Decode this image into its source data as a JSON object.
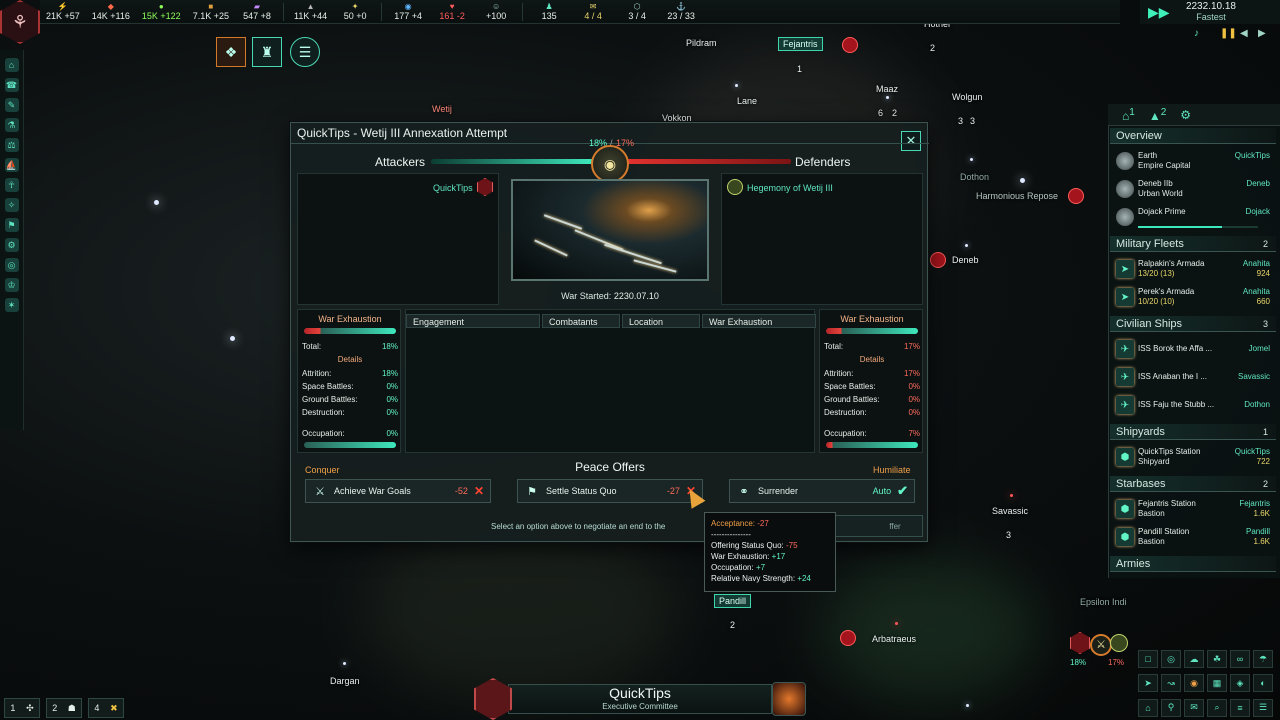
{
  "topbar": {
    "resources": [
      {
        "icon": "energy-icon",
        "value": "21K +57"
      },
      {
        "icon": "minerals-icon",
        "value": "14K +116"
      },
      {
        "icon": "food-icon",
        "value": "15K +122",
        "color": "#8cff5a"
      },
      {
        "icon": "consumer-goods-icon",
        "value": "7.1K +25"
      },
      {
        "icon": "alloys-icon",
        "value": "547 +8"
      },
      {
        "icon": "influence-icon",
        "value": "11K +44"
      },
      {
        "icon": "unity-icon",
        "value": "50 +0"
      },
      {
        "icon": "research-icon",
        "value": "177 +4"
      },
      {
        "icon": "stability-icon",
        "value": "161 -2",
        "negative": true
      },
      {
        "icon": "amenities-icon",
        "value": "+100"
      },
      {
        "icon": "pops-icon",
        "value": "135"
      },
      {
        "icon": "envoys-icon",
        "value": "4 / 4",
        "color": "#e8d66a"
      },
      {
        "icon": "starbases-icon",
        "value": "3 / 4"
      },
      {
        "icon": "naval-capacity-icon",
        "value": "23 / 33"
      }
    ],
    "date": "2232.10.18",
    "speed": "Fastest"
  },
  "window": {
    "title": "QuickTips - Wetij III Annexation Attempt",
    "attackers_label": "Attackers",
    "defenders_label": "Defenders",
    "attacker_pct": "18%",
    "defender_pct": "17%",
    "slash": "/",
    "attacker_name": "QuickTips",
    "defender_name": "Hegemony of Wetij III",
    "war_started_label": "War Started:",
    "war_started_date": "2230.07.10",
    "exhaustion_left": {
      "title": "War Exhaustion",
      "total_label": "Total:",
      "total": "18%",
      "details": "Details",
      "rows": [
        {
          "label": "Attrition:",
          "value": "18%"
        },
        {
          "label": "Space Battles:",
          "value": "0%"
        },
        {
          "label": "Ground Battles:",
          "value": "0%"
        },
        {
          "label": "Destruction:",
          "value": "0%"
        }
      ],
      "occupation_label": "Occupation:",
      "occupation": "0%"
    },
    "exhaustion_right": {
      "title": "War Exhaustion",
      "total_label": "Total:",
      "total": "17%",
      "details": "Details",
      "rows": [
        {
          "label": "Attrition:",
          "value": "17%"
        },
        {
          "label": "Space Battles:",
          "value": "0%"
        },
        {
          "label": "Ground Battles:",
          "value": "0%"
        },
        {
          "label": "Destruction:",
          "value": "0%"
        }
      ],
      "occupation_label": "Occupation:",
      "occupation": "7%"
    },
    "engagement_headers": [
      "Engagement",
      "Combatants",
      "Location",
      "War Exhaustion"
    ],
    "peace_offers_title": "Peace Offers",
    "conquer_label": "Conquer",
    "humiliate_label": "Humiliate",
    "offers": [
      {
        "label": "Achieve War Goals",
        "value": "-52",
        "icon": "crossed-swords-icon"
      },
      {
        "label": "Settle Status Quo",
        "value": "-27",
        "icon": "flag-icon"
      },
      {
        "label": "Surrender",
        "value": "Auto",
        "icon": "handshake-icon"
      }
    ],
    "hint": "Select an option above to negotiate an end to the",
    "send_offer": "ffer"
  },
  "tooltip": {
    "header": "Acceptance:",
    "header_value": "-27",
    "separator": "---------------",
    "lines": [
      {
        "label": "Offering Status Quo:",
        "value": "-75",
        "negative": true
      },
      {
        "label": "War Exhaustion:",
        "value": "+17"
      },
      {
        "label": "Occupation:",
        "value": "+7"
      },
      {
        "label": "Relative Navy Strength:",
        "value": "+24"
      }
    ]
  },
  "map": {
    "labels": [
      "Pildram",
      "Fejantris",
      "Lane",
      "Maaz",
      "Wolgun",
      "Vokkon",
      "Wetij",
      "Dothon",
      "Harmonious Repose",
      "Deneb",
      "Savassic",
      "Pandill",
      "Arbatraeus",
      "Dargan",
      "Epsilon Indi",
      "Hother"
    ],
    "counts": {
      "fejantris": "1",
      "maaz_a": "6",
      "maaz_b": "2",
      "wolgun_a": "3",
      "wolgun_b": "3",
      "savassic": "3",
      "pandill": "2",
      "hother": "2"
    }
  },
  "outliner": {
    "tabs": [
      "1",
      "2",
      "gear"
    ],
    "overview": "Overview",
    "planets": [
      {
        "name": "Earth",
        "type": "Empire Capital",
        "owner": "QuickTips"
      },
      {
        "name": "Deneb IIb",
        "type": "Urban World",
        "owner": "Deneb"
      },
      {
        "name": "Dojack Prime",
        "type": "",
        "owner": "Dojack"
      }
    ],
    "military_fleets": {
      "label": "Military Fleets",
      "count": "2",
      "items": [
        {
          "name": "Ralpakin's Armada",
          "size": "13/20 (13)",
          "location": "Anahita",
          "power": "924"
        },
        {
          "name": "Perek's Armada",
          "size": "10/20 (10)",
          "location": "Anahita",
          "power": "660"
        }
      ]
    },
    "civilian_ships": {
      "label": "Civilian Ships",
      "count": "3",
      "items": [
        {
          "name": "ISS Borok the Affa ...",
          "location": "Jomel"
        },
        {
          "name": "ISS Anaban the I ...",
          "location": "Savassic"
        },
        {
          "name": "ISS Faju the Stubb ...",
          "location": "Dothon"
        }
      ]
    },
    "shipyards": {
      "label": "Shipyards",
      "count": "1",
      "items": [
        {
          "name": "QuickTips Station",
          "sub": "Shipyard",
          "owner": "QuickTips",
          "value": "722"
        }
      ]
    },
    "starbases": {
      "label": "Starbases",
      "count": "2",
      "items": [
        {
          "name": "Fejantris Station",
          "sub": "Bastion",
          "owner": "Fejantris",
          "value": "1.6K"
        },
        {
          "name": "Pandill Station",
          "sub": "Bastion",
          "owner": "Pandill",
          "value": "1.6K"
        }
      ]
    },
    "armies": "Armies"
  },
  "bottom": {
    "buttons": [
      {
        "num": "1"
      },
      {
        "num": "2"
      },
      {
        "num": "4"
      }
    ],
    "empire_name": "QuickTips",
    "empire_subtitle": "Executive Committee",
    "mini_war_left": "18%",
    "mini_war_right": "17%"
  }
}
